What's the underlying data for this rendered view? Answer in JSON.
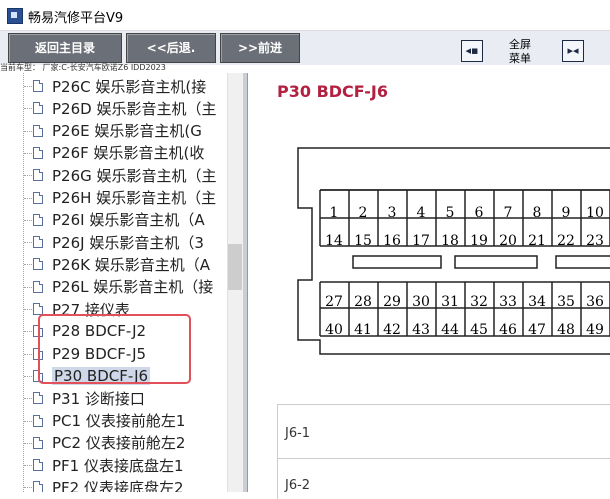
{
  "window": {
    "title": "畅易汽修平台V9"
  },
  "toolbar": {
    "back_main": "返回主目录",
    "back": "<<后退.",
    "forward": ">>前进",
    "fullscreen_line1": "全屏",
    "fullscreen_line2": "菜单"
  },
  "vehicle": {
    "label": "当前车型：  厂家:C-长安汽车欧诺Z6 IDD2023"
  },
  "tree": {
    "items": [
      {
        "label": "P26C 娱乐影音主机(接"
      },
      {
        "label": "P26D 娱乐影音主机（主"
      },
      {
        "label": "P26E 娱乐影音主机(G"
      },
      {
        "label": "P26F 娱乐影音主机(收"
      },
      {
        "label": "P26G 娱乐影音主机（主"
      },
      {
        "label": "P26H 娱乐影音主机（主"
      },
      {
        "label": "P26I 娱乐影音主机（A"
      },
      {
        "label": "P26J 娱乐影音主机（3"
      },
      {
        "label": "P26K 娱乐影音主机（A"
      },
      {
        "label": "P26L 娱乐影音主机（接"
      },
      {
        "label": "P27 接仪表"
      },
      {
        "label": "P28 BDCF-J2"
      },
      {
        "label": "P29 BDCF-J5"
      },
      {
        "label": "P30 BDCF-J6"
      },
      {
        "label": "P31 诊断接口"
      },
      {
        "label": "PC1 仪表接前舱左1"
      },
      {
        "label": "PC2 仪表接前舱左2"
      },
      {
        "label": "PF1 仪表接底盘左1"
      },
      {
        "label": "PF2 仪表接底盘左2"
      }
    ],
    "selected": "P30 BDCF-J6"
  },
  "content": {
    "title": "P30 BDCF-J6",
    "connector_pins": {
      "row1": [
        "1",
        "2",
        "3",
        "4",
        "5",
        "6",
        "7",
        "8",
        "9",
        "10"
      ],
      "row2": [
        "14",
        "15",
        "16",
        "17",
        "18",
        "19",
        "20",
        "21",
        "22",
        "23"
      ],
      "row3": [
        "27",
        "28",
        "29",
        "30",
        "31",
        "32",
        "33",
        "34",
        "35",
        "36"
      ],
      "row4": [
        "40",
        "41",
        "42",
        "43",
        "44",
        "45",
        "46",
        "47",
        "48",
        "49"
      ]
    },
    "table_rows": [
      {
        "label": "J6-1"
      },
      {
        "label": "J6-2"
      }
    ]
  }
}
